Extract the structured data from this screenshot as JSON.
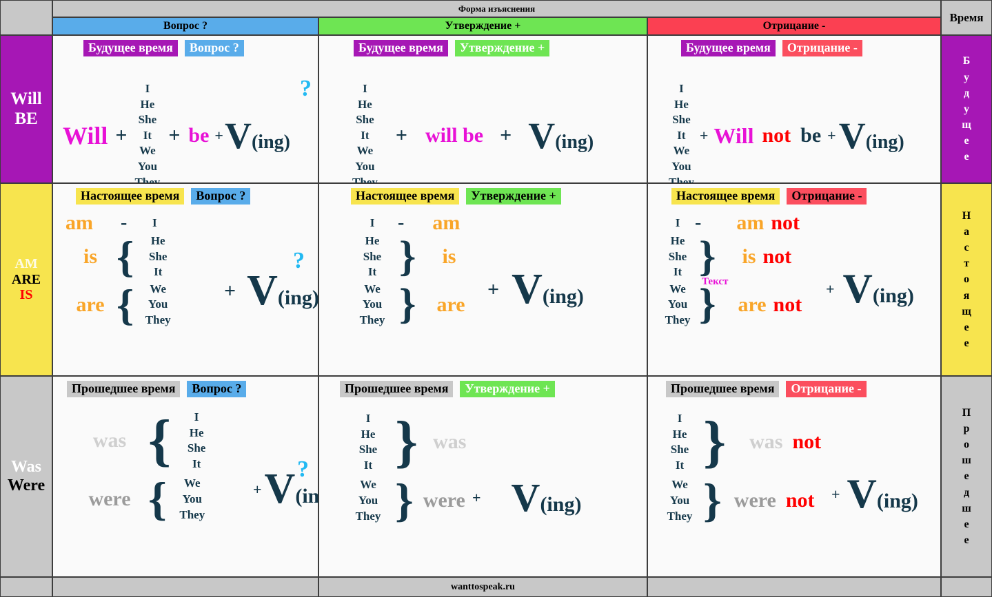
{
  "header": {
    "form_title": "Форма изъяснения",
    "time_col_title": "Время",
    "columns": [
      {
        "key": "question",
        "label": "Вопрос ?",
        "color": "#59acea"
      },
      {
        "key": "affirmative",
        "label": "Утверждение +",
        "color": "#6ee553"
      },
      {
        "key": "negative",
        "label": "Отрицание -",
        "color": "#fb4052"
      }
    ]
  },
  "rows": [
    {
      "key": "future",
      "left_label_line1": "Will",
      "left_label_line2": "BE",
      "left_bg": "#a617b5",
      "tense_tag": "Будущее время",
      "vertical_label": "Будущее",
      "vertical_letters": [
        "Б",
        "у",
        "д",
        "у",
        "щ",
        "е",
        "е"
      ]
    },
    {
      "key": "present",
      "left_label_line1": "AM",
      "left_label_line2": "ARE",
      "left_label_line3": "IS",
      "left_bg": "#f7e44e",
      "tense_tag": "Настоящее время",
      "vertical_label": "Настоящее",
      "vertical_letters": [
        "Н",
        "а",
        "с",
        "т",
        "о",
        "я",
        "щ",
        "е",
        "е"
      ]
    },
    {
      "key": "past",
      "left_label_line1": "Was",
      "left_label_line2": "Were",
      "left_bg": "#c8c8c8",
      "tense_tag": "Прошедшее время",
      "vertical_label": "Прошедшее",
      "vertical_letters": [
        "П",
        "р",
        "о",
        "ш",
        "е",
        "д",
        "ш",
        "е",
        "е"
      ]
    }
  ],
  "pronouns": {
    "all": [
      "I",
      "He",
      "She",
      "It",
      "We",
      "You",
      "They"
    ],
    "i": [
      "I"
    ],
    "he_she_it": [
      "He",
      "She",
      "It"
    ],
    "we_you_they": [
      "We",
      "You",
      "They"
    ],
    "i_he_she_it": [
      "I",
      "He",
      "She",
      "It"
    ]
  },
  "cells": {
    "future_question": {
      "tense_tag": "Будущее время",
      "form_tag": "Вопрос  ?",
      "will": "Will",
      "plus1": "+",
      "plus2": "+",
      "be": "be",
      "plus3": "+",
      "verb": "V",
      "verb_suffix": "(ing)",
      "question_mark": "?"
    },
    "future_affirmative": {
      "tense_tag": "Будущее время",
      "form_tag": "Утверждение  +",
      "plus1": "+",
      "will_be": "will be",
      "plus2": "+",
      "verb": "V",
      "verb_suffix": "(ing)"
    },
    "future_negative": {
      "tense_tag": "Будущее время",
      "form_tag": "Отрицание -",
      "plus1": "+",
      "will": "Will",
      "not": "not",
      "be": "be",
      "plus2": "+",
      "verb": "V",
      "verb_suffix": "(ing)"
    },
    "present_question": {
      "tense_tag": "Настоящее время",
      "form_tag": "Вопрос ?",
      "am": "am",
      "dash": "-",
      "is": "is",
      "are": "are",
      "plus": "+",
      "verb": "V",
      "verb_suffix": "(ing)",
      "question_mark": "?"
    },
    "present_affirmative": {
      "tense_tag": "Настоящее время",
      "form_tag": "Утверждение  +",
      "dash": "-",
      "am": "am",
      "is": "is",
      "are": "are",
      "plus": "+",
      "verb": "V",
      "verb_suffix": "(ing)"
    },
    "present_negative": {
      "tense_tag": "Настоящее время",
      "form_tag": "Отрицание -",
      "dash": "-",
      "am": "am",
      "is": "is",
      "are": "are",
      "not": "not",
      "plus": "+",
      "verb": "V",
      "verb_suffix": "(ing)",
      "annotation": "Текст"
    },
    "past_question": {
      "tense_tag": "Прошедшее время",
      "form_tag": "Вопрос   ?",
      "was": "was",
      "were": "were",
      "plus": "+",
      "verb": "V",
      "verb_suffix": "(ing)",
      "question_mark": "?"
    },
    "past_affirmative": {
      "tense_tag": "Прошедшее время",
      "form_tag": "Утверждение +",
      "was": "was",
      "were": "were",
      "plus": "+",
      "verb": "V",
      "verb_suffix": "(ing)"
    },
    "past_negative": {
      "tense_tag": "Прошедшее время",
      "form_tag": "Отрицание -",
      "was": "was",
      "were": "were",
      "not": "not",
      "plus": "+",
      "verb": "V",
      "verb_suffix": "(ing)"
    }
  },
  "footer": {
    "site": "wanttospeak.ru"
  },
  "colors": {
    "question": "#59acea",
    "affirmative": "#6ee553",
    "negative": "#fb4052",
    "future": "#a617b5",
    "present": "#f7e44e",
    "past": "#c8c8c8",
    "ink": "#15384a",
    "orange": "#f9a528",
    "red": "#ff0000",
    "magenta": "#e811d6",
    "cyan": "#22b9f2"
  }
}
